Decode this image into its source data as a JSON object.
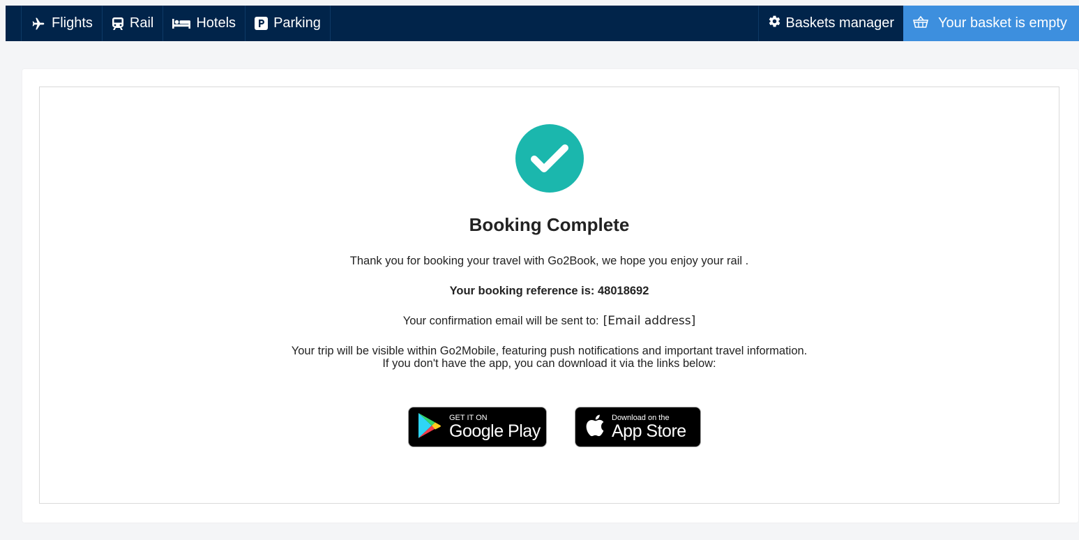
{
  "nav": {
    "items": [
      {
        "label": "Flights",
        "icon": "plane-icon"
      },
      {
        "label": "Rail",
        "icon": "train-icon"
      },
      {
        "label": "Hotels",
        "icon": "bed-icon"
      },
      {
        "label": "Parking",
        "icon": "parking-icon"
      }
    ],
    "baskets_manager": "Baskets manager",
    "basket_status": "Your basket is empty"
  },
  "confirmation": {
    "title": "Booking Complete",
    "thanks": "Thank you for booking your travel with Go2Book, we hope you enjoy your rail .",
    "reference_label": "Your booking reference is: 48018692",
    "email_label": "Your confirmation email will be sent to:",
    "email_value": "[Email address]",
    "app_line1": "Your trip will be visible within Go2Mobile, featuring push notifications and important travel information.",
    "app_line2": "If you don't have the app, you can download it via the links below:"
  },
  "stores": {
    "google_small": "GET IT ON",
    "google_big": "Google Play",
    "apple_small": "Download on the",
    "apple_big": "App Store"
  },
  "colors": {
    "nav_bg": "#01244a",
    "basket_bg": "#3d8fde",
    "success": "#1bb7ad"
  }
}
